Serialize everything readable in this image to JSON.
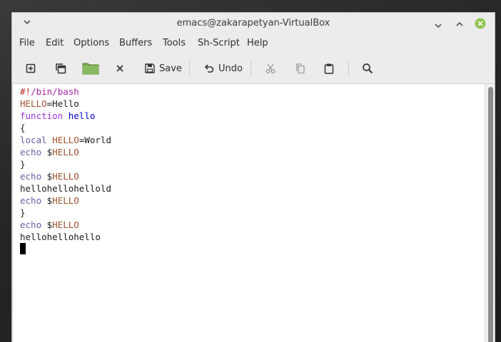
{
  "window": {
    "title": "emacs@zakarapetyan-VirtualBox"
  },
  "menubar": {
    "items": [
      "File",
      "Edit",
      "Options",
      "Buffers",
      "Tools",
      "Sh-Script",
      "Help"
    ]
  },
  "toolbar": {
    "new_file_icon": "new-file-icon",
    "open_file_icon": "copy-windows-icon",
    "open_dir_icon": "folder-icon",
    "close_icon": "close-x-icon",
    "save_label": "Save",
    "undo_label": "Undo",
    "cut_icon": "scissors-icon",
    "copy_icon": "copy-icon",
    "paste_icon": "paste-icon",
    "search_icon": "search-icon"
  },
  "editor": {
    "lines": [
      {
        "kind": "shebang",
        "prefix": "#!",
        "path": "/bin/bash"
      },
      {
        "kind": "assign",
        "var": "HELLO",
        "op": "=",
        "value": "Hello"
      },
      {
        "kind": "funcdef",
        "keyword": "function",
        "name": "hello"
      },
      {
        "kind": "plain",
        "text": "{"
      },
      {
        "kind": "local",
        "keyword": "local",
        "var": "HELLO",
        "op": "=",
        "value": "World"
      },
      {
        "kind": "echo",
        "cmd": "echo",
        "dollar": " $",
        "var": "HELLO"
      },
      {
        "kind": "plain",
        "text": "}"
      },
      {
        "kind": "echo",
        "cmd": "echo",
        "dollar": " $",
        "var": "HELLO"
      },
      {
        "kind": "plain",
        "text": "hellohellohellold"
      },
      {
        "kind": "echo",
        "cmd": "echo",
        "dollar": " $",
        "var": "HELLO"
      },
      {
        "kind": "plain",
        "text": "}"
      },
      {
        "kind": "echo",
        "cmd": "echo",
        "dollar": " $",
        "var": "HELLO"
      },
      {
        "kind": "plain",
        "text": "hellohellohello"
      },
      {
        "kind": "cursor",
        "text": ""
      }
    ]
  },
  "colors": {
    "titlebar_bg": "#ececec",
    "close_button": "#8fc553",
    "shebang": "#b5262a",
    "variable": "#a0522d",
    "keyword": "#9b30d9",
    "function_name": "#0000cc",
    "builtin": "#6f5aa8"
  }
}
